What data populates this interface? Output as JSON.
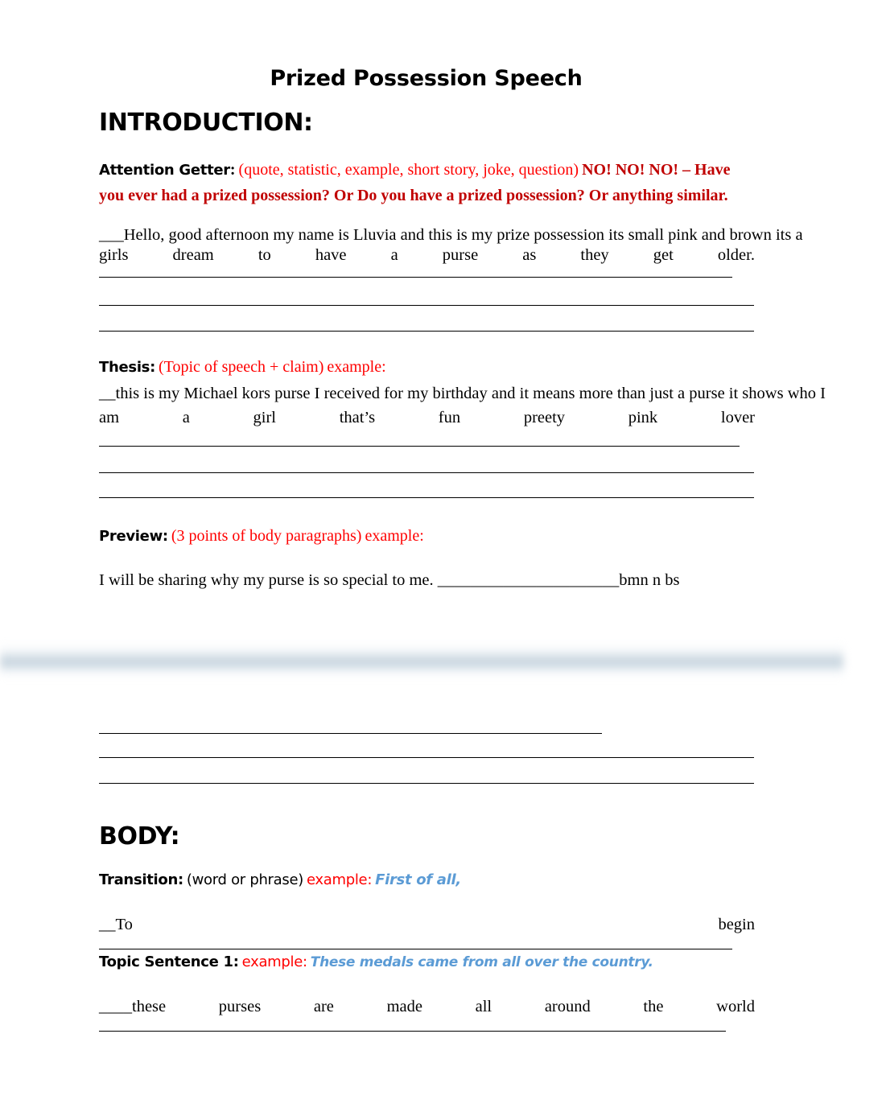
{
  "document": {
    "title": "Prized Possession Speech"
  },
  "sections": {
    "introduction": {
      "heading": "INTRODUCTION:",
      "attention_getter": {
        "label": "Attention Getter",
        "label_colon": ":",
        "hint": "(quote, statistic, example, short story, joke, question)",
        "example_bold": "NO! NO! NO! – Have you ever had a prized possession?  Or Do you have a prized possession?  Or  anything similar.",
        "student_response_line1": "___Hello, good afternoon my name is Lluvia and this is my prize possession its small pink and brown its a",
        "student_response_line2_words": [
          "girls",
          "dream",
          "to",
          "have",
          "a",
          "purse",
          "as",
          "they",
          "get",
          "older."
        ]
      },
      "thesis": {
        "label": "Thesis:",
        "hint": "(Topic of speech + claim)",
        "example_word": "example:",
        "student_response_line1": "__this is my Michael kors purse I received for my birthday and it means more than just a purse it shows who I",
        "student_response_line2_words": [
          "am",
          "a",
          "girl",
          "that’s",
          "fun",
          "preety",
          "pink",
          "lover"
        ]
      },
      "preview": {
        "label": "Preview:",
        "hint": "(3 points of body paragraphs)",
        "example_word": "example:",
        "student_response": "I will be sharing why my purse is so special to me. ______________________bmn n   bs"
      }
    },
    "body": {
      "heading": "BODY:",
      "transition": {
        "label": "Transition:",
        "hint": "(word or phrase)",
        "example_word": "example:",
        "example_text": "First of all,",
        "student_start": "__To",
        "student_end": "begin"
      },
      "topic_sentence_1": {
        "label": "Topic Sentence 1:",
        "example_word": "example:",
        "example_text": "These medals came from all over the country.",
        "student_response_words": [
          "____these",
          "purses",
          "are",
          "made",
          "all",
          "around",
          "the",
          "world"
        ]
      }
    }
  },
  "colors": {
    "hint_red": "#ff0000",
    "emphasis_dark_red": "#c00000",
    "example_blue": "#5b9bd5",
    "text_black": "#000000",
    "page_band": "#c8d5df"
  }
}
